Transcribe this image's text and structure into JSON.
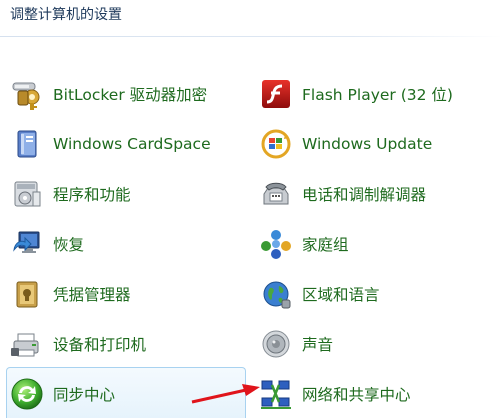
{
  "header": {
    "title": "调整计算机的设置"
  },
  "items": [
    {
      "label": "BitLocker 驱动器加密",
      "icon": "bitlocker-keys-icon"
    },
    {
      "label": "Flash Player (32 位)",
      "icon": "flash-player-icon"
    },
    {
      "label": "Windows CardSpace",
      "icon": "cardspace-icon"
    },
    {
      "label": "Windows Update",
      "icon": "windows-update-icon"
    },
    {
      "label": "程序和功能",
      "icon": "programs-features-icon"
    },
    {
      "label": "电话和调制解调器",
      "icon": "phone-modem-icon"
    },
    {
      "label": "恢复",
      "icon": "recovery-icon"
    },
    {
      "label": "家庭组",
      "icon": "homegroup-icon"
    },
    {
      "label": "凭据管理器",
      "icon": "credential-manager-icon"
    },
    {
      "label": "区域和语言",
      "icon": "region-language-icon"
    },
    {
      "label": "设备和打印机",
      "icon": "devices-printers-icon"
    },
    {
      "label": "声音",
      "icon": "sound-icon"
    },
    {
      "label": "同步中心",
      "icon": "sync-center-icon"
    },
    {
      "label": "网络和共享中心",
      "icon": "network-sharing-icon"
    }
  ],
  "colors": {
    "link": "#1e6a1e",
    "header": "#1e395b",
    "arrow": "#e0141b",
    "hover_border": "#a8d2f0"
  }
}
